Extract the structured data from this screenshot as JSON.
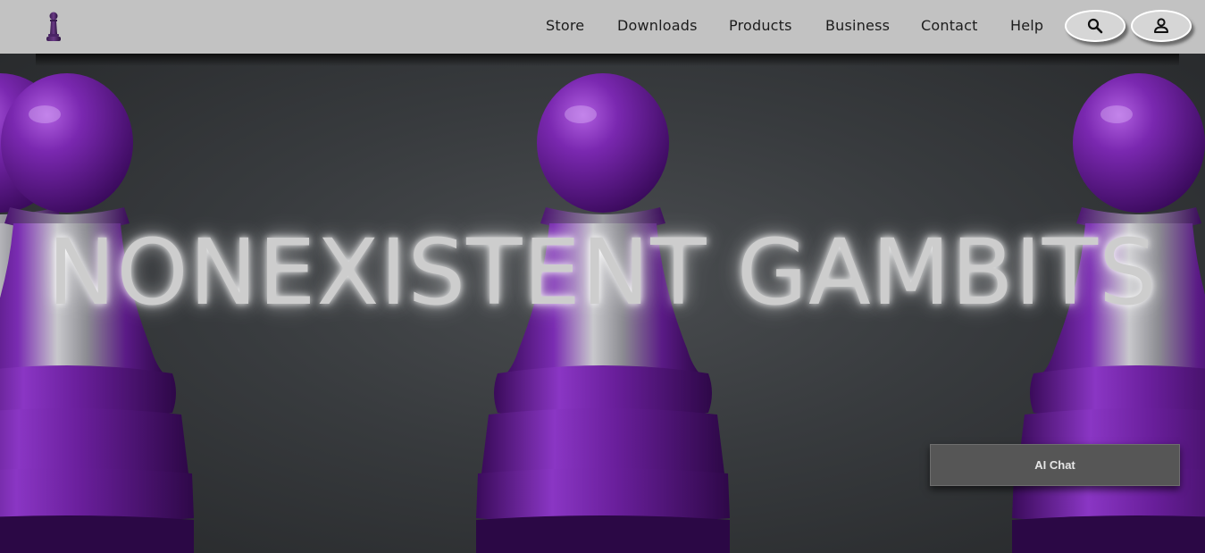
{
  "header": {
    "logo_icon": "pawn-logo-icon",
    "nav": [
      {
        "label": "Store"
      },
      {
        "label": "Downloads"
      },
      {
        "label": "Products"
      },
      {
        "label": "Business"
      },
      {
        "label": "Contact"
      },
      {
        "label": "Help"
      }
    ],
    "search_icon": "search-icon",
    "account_icon": "user-icon"
  },
  "hero": {
    "title": "NONEXISTENT GAMBITS",
    "image": "three-purple-pawns-background"
  },
  "chat": {
    "label": "AI Chat"
  },
  "colors": {
    "header_bg": "#c2c2c2",
    "pawn_purple": "#6a1f9c",
    "hero_bg": "#383b3e",
    "title_glow": "#cdcdcd",
    "chat_bg": "#565656"
  }
}
